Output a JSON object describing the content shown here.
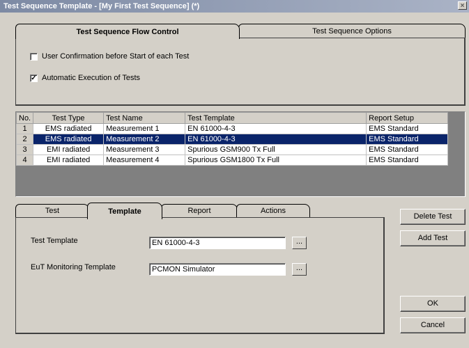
{
  "window": {
    "title": "Test Sequence Template - [My First Test Sequence] (*)",
    "close_glyph": "×"
  },
  "top_tabs": [
    {
      "label": "Test Sequence Flow Control",
      "active": true
    },
    {
      "label": "Test Sequence Options",
      "active": false
    }
  ],
  "flow_control": {
    "user_confirmation": {
      "label": "User Confirmation before Start of each Test",
      "checked": false,
      "mark": ""
    },
    "automatic_execution": {
      "label": "Automatic Execution of Tests",
      "checked": true,
      "mark": "✓"
    }
  },
  "table": {
    "columns": [
      "No.",
      "Test Type",
      "Test Name",
      "Test Template",
      "Report Setup"
    ],
    "rows": [
      {
        "no": "1",
        "type": "EMS radiated",
        "name": "Measurement 1",
        "template": "EN 61000-4-3",
        "report": "EMS Standard",
        "selected": false
      },
      {
        "no": "2",
        "type": "EMS radiated",
        "name": "Measurement 2",
        "template": "EN 61000-4-3",
        "report": "EMS Standard",
        "selected": true
      },
      {
        "no": "3",
        "type": "EMI radiated",
        "name": "Measurement 3",
        "template": "Spurious GSM900 Tx Full",
        "report": "EMS Standard",
        "selected": false
      },
      {
        "no": "4",
        "type": "EMI radiated",
        "name": "Measurement 4",
        "template": "Spurious GSM1800 Tx Full",
        "report": "EMS Standard",
        "selected": false
      }
    ]
  },
  "bottom_tabs": [
    {
      "label": "Test",
      "active": false
    },
    {
      "label": "Template",
      "active": true
    },
    {
      "label": "Report",
      "active": false
    },
    {
      "label": "Actions",
      "active": false
    }
  ],
  "template_tab": {
    "test_template_label": "Test Template",
    "test_template_value": "EN 61000-4-3",
    "eut_label": "EuT Monitoring Template",
    "eut_value": "PCMON Simulator",
    "browse_label": "..."
  },
  "buttons": {
    "delete_test": "Delete Test",
    "add_test": "Add Test",
    "ok": "OK",
    "cancel": "Cancel"
  }
}
